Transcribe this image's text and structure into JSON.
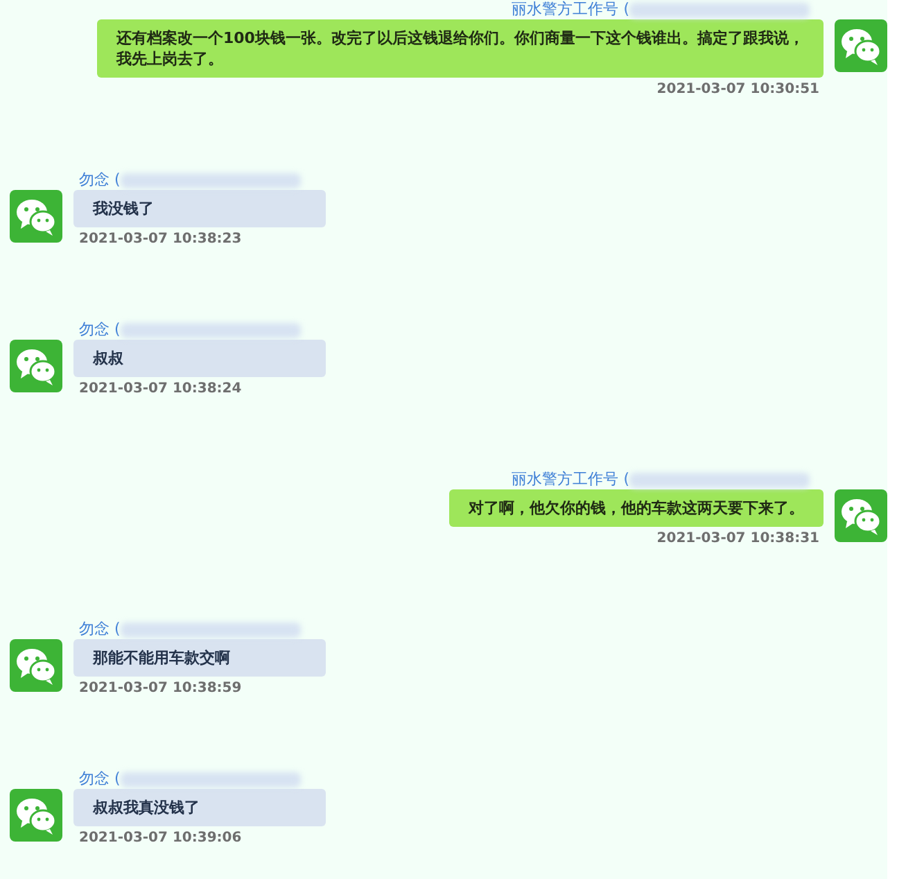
{
  "messages": [
    {
      "kind": "sent",
      "sender": "丽水警方工作号 (",
      "text": "还有档案改一个100块钱一张。改完了以后这钱退给你们。你们商量一下这个钱谁出。搞定了跟我说，我先上岗去了。",
      "time": "2021-03-07 10:30:51"
    },
    {
      "kind": "received",
      "sender": "勿念 (",
      "text": "我没钱了",
      "time": "2021-03-07 10:38:23"
    },
    {
      "kind": "received",
      "sender": "勿念 (",
      "text": "叔叔",
      "time": "2021-03-07 10:38:24"
    },
    {
      "kind": "sent",
      "sender": "丽水警方工作号 (",
      "text": "对了啊，他欠你的钱，他的车款这两天要下来了。",
      "time": "2021-03-07 10:38:31"
    },
    {
      "kind": "received",
      "sender": "勿念 (",
      "text": "那能不能用车款交啊",
      "time": "2021-03-07 10:38:59"
    },
    {
      "kind": "received",
      "sender": "勿念 (",
      "text": "叔叔我真没钱了",
      "time": "2021-03-07 10:39:06"
    }
  ]
}
